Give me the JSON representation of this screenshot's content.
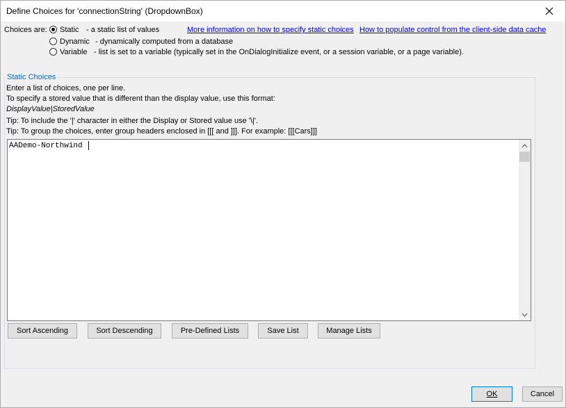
{
  "window": {
    "title": "Define Choices for 'connectionString' (DropdownBox)"
  },
  "choices": {
    "label": "Choices are:",
    "options": [
      {
        "name": "Static",
        "desc": "- a static list of values",
        "checked": true
      },
      {
        "name": "Dynamic",
        "desc": "- dynamically computed from a database",
        "checked": false
      },
      {
        "name": "Variable",
        "desc": "- list is set to a variable (typically set in the OnDialogInitialize event, or a session variable, or a page variable).",
        "checked": false
      }
    ],
    "link_static": "More information on how to specify static choices",
    "link_cache": "How to populate control from the client-side data cache"
  },
  "static_choices": {
    "group_label": "Static Choices",
    "instructions": [
      "Enter a list of choices, one per line.",
      "To specify a stored value that is different than the display value, use this format:",
      "DisplayValue|StoredValue",
      "Tip: To include the '|' character in either the Display or Stored value use '\\|'.",
      "Tip: To group the choices, enter group headers enclosed in [[[ and ]]]. For example: [[[Cars]]]"
    ],
    "content": "AADemo-Northwind"
  },
  "buttons": {
    "sort_asc": "Sort Ascending",
    "sort_desc": "Sort Descending",
    "predefined": "Pre-Defined Lists",
    "save_list": "Save List",
    "manage_lists": "Manage Lists",
    "ok": "OK",
    "cancel": "Cancel"
  },
  "colors": {
    "link": "#0000ee",
    "group_label": "#0066cc",
    "default_button_border": "#0078d7"
  }
}
